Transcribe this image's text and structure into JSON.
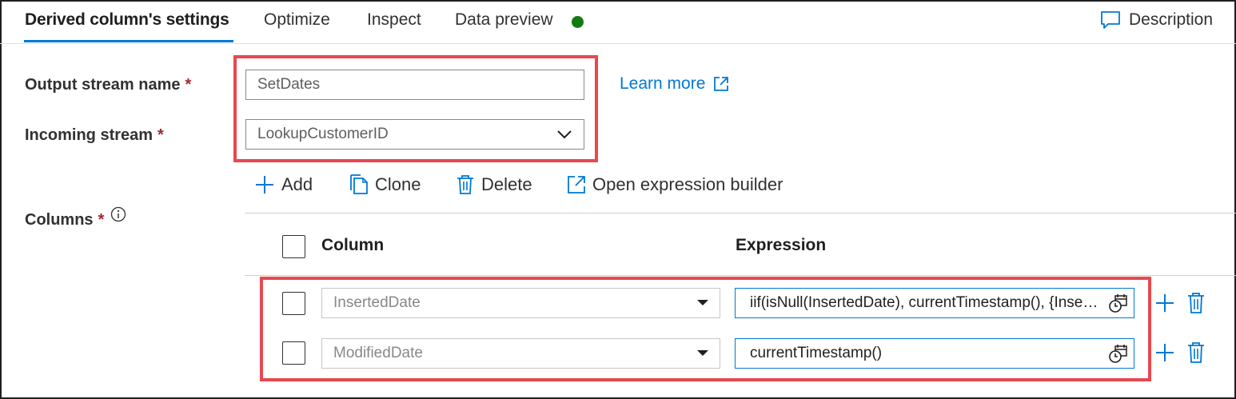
{
  "tabs": [
    {
      "label": "Derived column's settings"
    },
    {
      "label": "Optimize"
    },
    {
      "label": "Inspect"
    },
    {
      "label": "Data preview"
    }
  ],
  "description_label": "Description",
  "form": {
    "output_stream_label": "Output stream name",
    "output_stream_value": "SetDates",
    "incoming_stream_label": "Incoming stream",
    "incoming_stream_value": "LookupCustomerID",
    "required_marker": "*",
    "learn_more": "Learn more",
    "columns_label": "Columns"
  },
  "toolbar": {
    "add": "Add",
    "clone": "Clone",
    "delete": "Delete",
    "open_builder": "Open expression builder"
  },
  "table": {
    "headers": {
      "column": "Column",
      "expression": "Expression"
    },
    "rows": [
      {
        "column": "InsertedDate",
        "expression": "iif(isNull(InsertedDate), currentTimestamp(), {InsertedDate})"
      },
      {
        "column": "ModifiedDate",
        "expression": "currentTimestamp()"
      }
    ]
  },
  "colors": {
    "accent": "#0078d4",
    "highlight": "#e8484f",
    "status_ok": "#107c10",
    "required": "#a4262c"
  }
}
